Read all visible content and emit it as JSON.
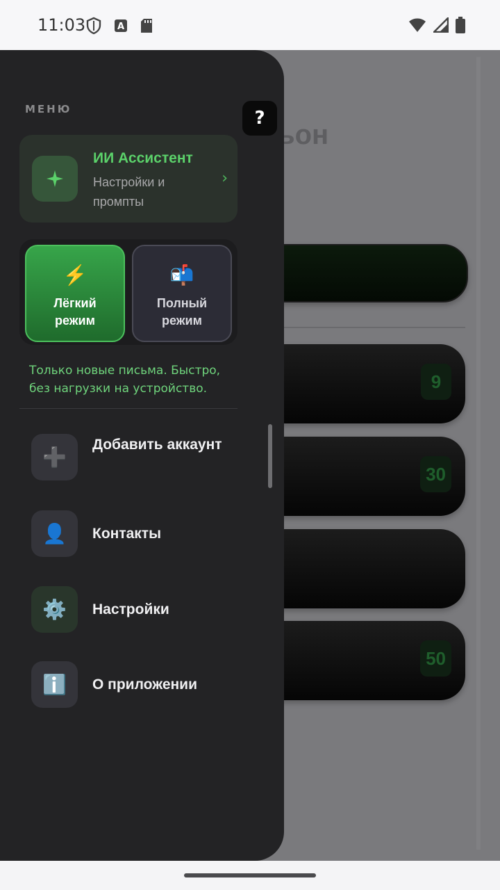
{
  "status_bar": {
    "time": "11:03",
    "left_icons": [
      "shield-icon",
      "a-icon",
      "sd-card-icon"
    ],
    "right_icons": [
      "wifi-icon",
      "signal-icon",
      "battery-icon"
    ]
  },
  "background": {
    "title_fragment": "ьон",
    "counts": [
      "9",
      "30",
      "50"
    ]
  },
  "drawer": {
    "menu_heading": "МЕНЮ",
    "help_label": "?",
    "ai_card": {
      "icon": "sparkle-icon",
      "title": "ИИ Ассистент",
      "subtitle": "Настройки и промпты",
      "chevron": "›"
    },
    "modes": {
      "light": {
        "emoji": "⚡",
        "label": "Лёгкий режим",
        "selected": true
      },
      "full": {
        "emoji": "📬",
        "label": "Полный режим",
        "selected": false
      }
    },
    "mode_description": "Только новые письма. Быстро, без нагрузки на устройство.",
    "items": [
      {
        "icon": "plus-icon",
        "glyph": "➕",
        "label": "Добавить аккаунт"
      },
      {
        "icon": "person-icon",
        "glyph": "👤",
        "label": "Контакты"
      },
      {
        "icon": "gear-icon",
        "glyph": "⚙️",
        "label": "Настройки"
      },
      {
        "icon": "info-icon",
        "glyph": "ℹ️",
        "label": "О приложении"
      }
    ]
  },
  "colors": {
    "accent_green": "#5bd16a",
    "drawer_bg": "#232325"
  }
}
